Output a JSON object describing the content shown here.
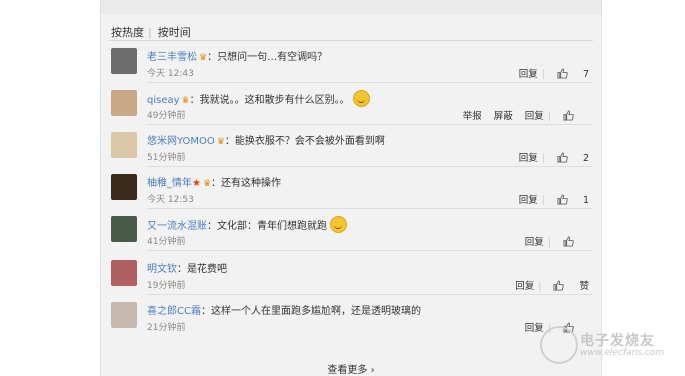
{
  "sort_tabs": [
    "按热度",
    "按时间"
  ],
  "comments": [
    {
      "name": "老三丰雪松",
      "text": "：只想问一句…有空调吗？",
      "time": "今天 12:43",
      "actions": [
        "回复"
      ],
      "likes": "7",
      "badge": true,
      "emoji": false,
      "star": false
    },
    {
      "name": "qiseay",
      "text": "：我就说。。这和散步有什么区别。。",
      "time": "49分钟前",
      "actions": [
        "举报",
        "屏蔽",
        "回复"
      ],
      "likes": "",
      "badge": true,
      "emoji": true,
      "star": false
    },
    {
      "name": "悠米网YOMOO",
      "text": "：能换衣服不？会不会被外面看到啊",
      "time": "51分钟前",
      "actions": [
        "回复"
      ],
      "likes": "2",
      "badge": true,
      "emoji": false,
      "star": false
    },
    {
      "name": "柚稚_情年",
      "text": "：还有这种操作",
      "time": "今天 12:53",
      "actions": [
        "回复"
      ],
      "likes": "1",
      "badge": true,
      "emoji": false,
      "star": true
    },
    {
      "name": "又一流水混账",
      "text": "：文化部：青年们想跑就跑",
      "time": "41分钟前",
      "actions": [
        "回复"
      ],
      "likes": "",
      "badge": false,
      "emoji": true,
      "star": false
    },
    {
      "name": "明文钦",
      "text": "：是花费吧",
      "time": "19分钟前",
      "actions": [
        "回复"
      ],
      "likes": "赞",
      "badge": false,
      "emoji": false,
      "star": false
    },
    {
      "name": "喜之郎CC霜",
      "text": "：这样一个人在里面跑多尴尬啊，还是透明玻璃的",
      "time": "21分钟前",
      "actions": [
        "回复"
      ],
      "likes": "",
      "badge": false,
      "emoji": false,
      "star": false
    }
  ],
  "more_label": "查看更多",
  "watermark": {
    "title": "电子发烧友",
    "url": "www.elecfans.com"
  },
  "colors": {
    "name": "#4a7ebf",
    "accent": "#e08b00"
  }
}
